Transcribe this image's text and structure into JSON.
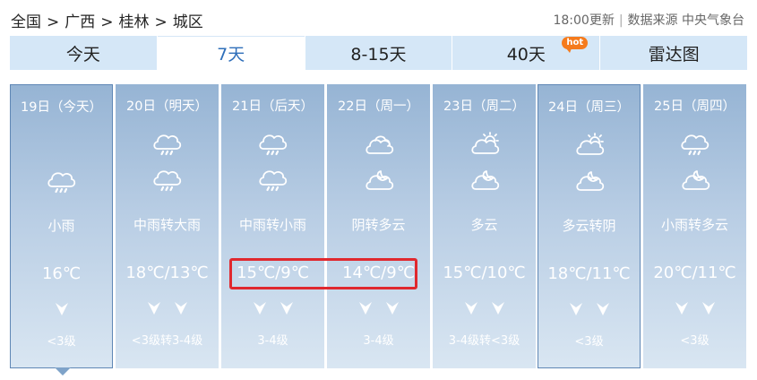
{
  "breadcrumb": {
    "items": [
      "全国",
      "广西",
      "桂林",
      "城区"
    ],
    "separator": ">"
  },
  "source": {
    "update_time": "18:00更新",
    "divider": "|",
    "label": "数据来源 中央气象台"
  },
  "tabs": [
    {
      "label": "今天",
      "active": false
    },
    {
      "label": "7天",
      "active": true
    },
    {
      "label": "8-15天",
      "active": false
    },
    {
      "label": "40天",
      "active": false,
      "badge": "hot"
    },
    {
      "label": "雷达图",
      "active": false
    }
  ],
  "days": [
    {
      "date": "19日（今天）",
      "icons": [
        "rain-icon"
      ],
      "weather": "小雨",
      "temp": "16℃",
      "arrows": 1,
      "wind": "<3级",
      "selected": true
    },
    {
      "date": "20日（明天）",
      "icons": [
        "rain-icon",
        "rain-icon"
      ],
      "weather": "中雨转大雨",
      "temp": "18℃/13℃",
      "arrows": 2,
      "wind": "<3级转3-4级",
      "selected": false
    },
    {
      "date": "21日（后天）",
      "icons": [
        "rain-icon",
        "rain-icon"
      ],
      "weather": "中雨转小雨",
      "temp": "15℃/9℃",
      "arrows": 2,
      "wind": "3-4级",
      "selected": false
    },
    {
      "date": "22日（周一）",
      "icons": [
        "overcast-icon",
        "cloudy-night-icon"
      ],
      "weather": "阴转多云",
      "temp": "14℃/9℃",
      "arrows": 2,
      "wind": "3-4级",
      "selected": false
    },
    {
      "date": "23日（周二）",
      "icons": [
        "partly-cloudy-icon",
        "cloudy-night-icon"
      ],
      "weather": "多云",
      "temp": "15℃/10℃",
      "arrows": 2,
      "wind": "3-4级转<3级",
      "selected": false
    },
    {
      "date": "24日（周三）",
      "icons": [
        "partly-cloudy-icon",
        "cloudy-night-icon"
      ],
      "weather": "多云转阴",
      "temp": "18℃/11℃",
      "arrows": 2,
      "wind": "<3级",
      "selected": true
    },
    {
      "date": "25日（周四）",
      "icons": [
        "rain-icon",
        "cloudy-night-icon"
      ],
      "weather": "小雨转多云",
      "temp": "20℃/11℃",
      "arrows": 2,
      "wind": "<3级",
      "selected": false
    }
  ],
  "colors": {
    "accent": "#2f6fba",
    "tab_bg": "#d5e7f7",
    "highlight": "#e0282e",
    "hot_badge": "#f57b1d"
  }
}
